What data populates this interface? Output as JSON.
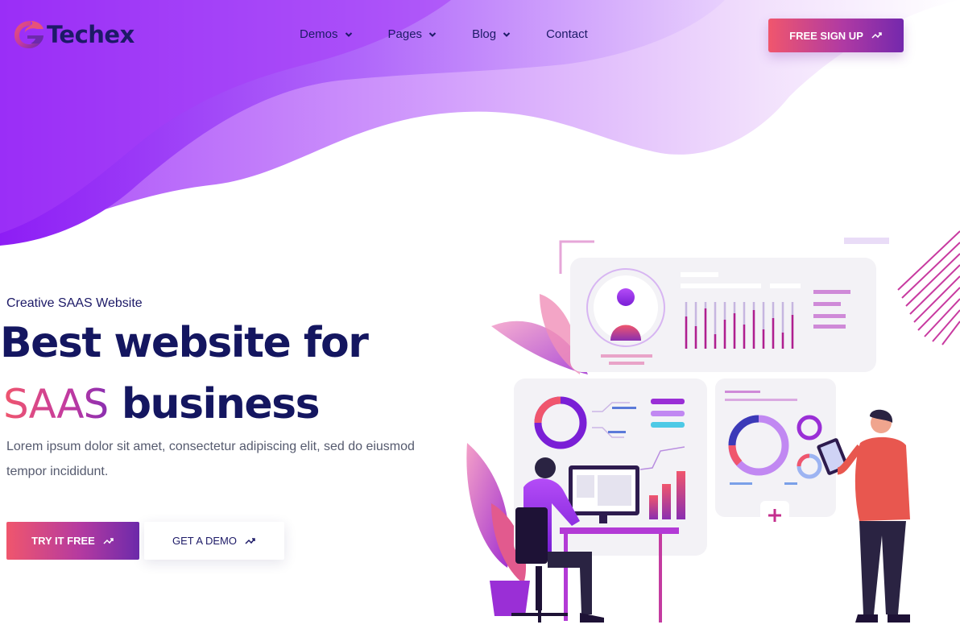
{
  "brand": {
    "name": "Techex",
    "logo_icon": "swirl-logo-icon"
  },
  "nav": {
    "items": [
      {
        "label": "Demos",
        "has_dropdown": true
      },
      {
        "label": "Pages",
        "has_dropdown": true
      },
      {
        "label": "Blog",
        "has_dropdown": true
      },
      {
        "label": "Contact",
        "has_dropdown": false
      }
    ]
  },
  "header": {
    "signup_label": "FREE SIGN UP"
  },
  "hero": {
    "tagline": "Creative SAAS Website",
    "headline_line1": "Best website for",
    "headline_accent": "SAAS",
    "headline_line2_rest": "business",
    "description": "Lorem ipsum dolor sit amet, consectetur adipiscing elit, sed do eiusmod tempor incididunt.",
    "try_label": "TRY IT FREE",
    "demo_label": "GET A DEMO"
  },
  "colors": {
    "primary_dark": "#1d1a67",
    "accent_pink": "#f0566d",
    "accent_purple": "#8a2be2",
    "button_gradient_end": "#6d2aab"
  }
}
